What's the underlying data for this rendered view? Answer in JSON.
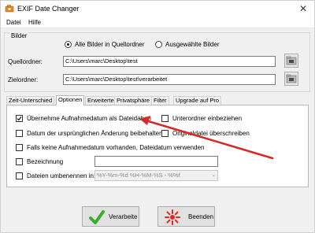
{
  "window": {
    "title": "EXIF Date Changer",
    "close_glyph": "✕"
  },
  "menu": {
    "items": [
      "Datei",
      "Hilfe"
    ]
  },
  "images_group": {
    "label": "Bilder",
    "radio_all": "Alle Bilder in Quellordner",
    "radio_selected": "Ausgewählte Bilder",
    "source_label": "Quellordner:",
    "source_value": "C:\\Users\\marc\\Desktop\\test",
    "target_label": "Zielordner:",
    "target_value": "C:\\Users\\marc\\Desktop\\test\\verarbeitet"
  },
  "tabs": [
    "Zeit-Unterschied",
    "Optionen",
    "Erweiterte",
    "Privatsphäre",
    "Filter",
    "Upgrade auf Pro"
  ],
  "active_tab": "Optionen",
  "options": {
    "take_date": "Übernehme Aufnahmedatum als Dateidatum",
    "take_date_checked": true,
    "subfolders": "Unterordner einbeziehen",
    "subfolders_checked": false,
    "keep_change_date": "Datum der ursprünglichen Änderung beibehalten",
    "keep_change_date_checked": false,
    "overwrite": "Originaldatei überschreiben",
    "overwrite_checked": false,
    "use_file_date": "Falls keine Aufnahmedatum vorhanden, Dateidatum verwenden",
    "use_file_date_checked": false,
    "designation": "Bezeichnung",
    "designation_checked": false,
    "designation_value": "",
    "rename": "Dateien umbenennen in:",
    "rename_checked": false,
    "rename_format": "%Y-%m-%d %H-%M-%S - %%f"
  },
  "buttons": {
    "process": "Verarbeite",
    "exit": "Beenden"
  },
  "colors": {
    "arrow": "#d42a2a",
    "check_green": "#3daa2e",
    "exit_red": "#e0261e"
  },
  "icons": [
    "camera-icon",
    "folder-icon",
    "checkmark-icon",
    "starburst-icon",
    "chevron-down-icon"
  ]
}
